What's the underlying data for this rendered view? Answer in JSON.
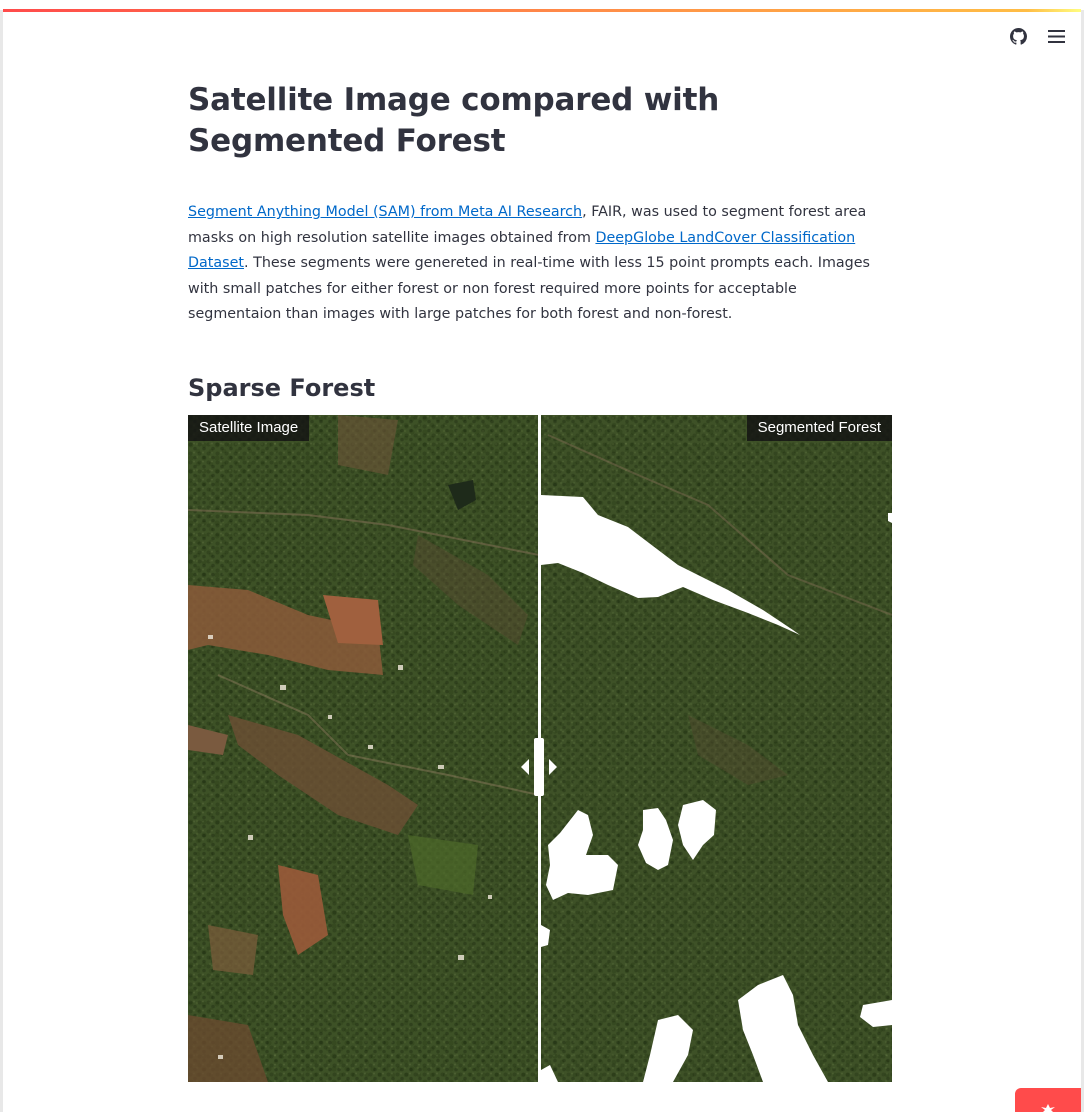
{
  "header": {
    "github_icon": "github-icon",
    "menu_icon": "hamburger-menu-icon",
    "accent_gradient": [
      "#ff4b4b",
      "#ffbd45",
      "#fffd80"
    ]
  },
  "page": {
    "title": "Satellite Image compared with Segmented Forest",
    "intro": {
      "link1_text": "Segment Anything Model (SAM) from Meta AI Research",
      "text1": ", FAIR, was used to segment forest area masks on high resolution satellite images obtained from ",
      "link2_text": "DeepGlobe LandCover Classification Dataset",
      "text2": ". These segments were genereted in real-time with less 15 point prompts each. Images with small patches for either forest or non forest required more points for acceptable segmentaion than images with large patches for both forest and non-forest."
    },
    "section_heading": "Sparse Forest",
    "comparison": {
      "left_label": "Satellite Image",
      "right_label": "Segmented Forest",
      "slider_position": 0.5
    }
  },
  "colors": {
    "link": "#0068c9",
    "text": "#31333F",
    "forest": "#3a4d23",
    "mask": "#ffffff",
    "status_widget": "#ff4b4b"
  }
}
